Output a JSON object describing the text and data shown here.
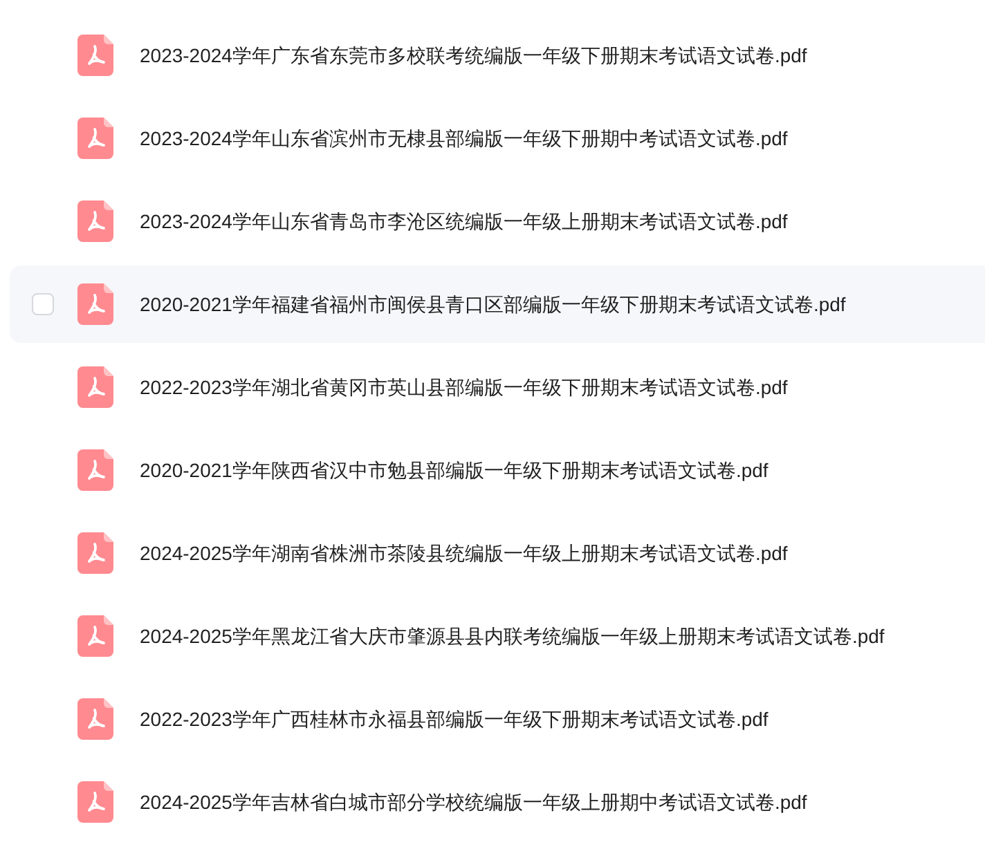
{
  "files": [
    {
      "name": "2023-2024学年广东省东莞市多校联考统编版一年级下册期末考试语文试卷.pdf",
      "hovered": false,
      "checked": false
    },
    {
      "name": "2023-2024学年山东省滨州市无棣县部编版一年级下册期中考试语文试卷.pdf",
      "hovered": false,
      "checked": false
    },
    {
      "name": "2023-2024学年山东省青岛市李沧区统编版一年级上册期末考试语文试卷.pdf",
      "hovered": false,
      "checked": false
    },
    {
      "name": "2020-2021学年福建省福州市闽侯县青口区部编版一年级下册期末考试语文试卷.pdf",
      "hovered": true,
      "checked": false
    },
    {
      "name": "2022-2023学年湖北省黄冈市英山县部编版一年级下册期末考试语文试卷.pdf",
      "hovered": false,
      "checked": false
    },
    {
      "name": "2020-2021学年陕西省汉中市勉县部编版一年级下册期末考试语文试卷.pdf",
      "hovered": false,
      "checked": false
    },
    {
      "name": "2024-2025学年湖南省株洲市茶陵县统编版一年级上册期末考试语文试卷.pdf",
      "hovered": false,
      "checked": false
    },
    {
      "name": "2024-2025学年黑龙江省大庆市肇源县县内联考统编版一年级上册期末考试语文试卷.pdf",
      "hovered": false,
      "checked": false
    },
    {
      "name": "2022-2023学年广西桂林市永福县部编版一年级下册期末考试语文试卷.pdf",
      "hovered": false,
      "checked": false
    },
    {
      "name": "2024-2025学年吉林省白城市部分学校统编版一年级上册期中考试语文试卷.pdf",
      "hovered": false,
      "checked": false
    }
  ]
}
